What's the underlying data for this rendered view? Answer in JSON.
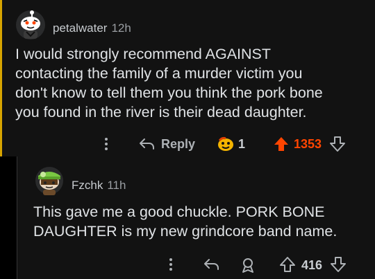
{
  "colors": {
    "background": "#000000",
    "comment_bg": "#121212",
    "thread_accent": "#d7a400",
    "upvote_active": "#ff4500",
    "text_primary": "#e0e3e6",
    "text_secondary": "#9a9ea2"
  },
  "comments": [
    {
      "username": "petalwater",
      "time": "12h",
      "body": "I would strongly recommend AGAINST\ncontacting the family of a murder victim you\ndon't know to tell them you think the pork bone\nyou found in the river is their dead daughter.",
      "actions": {
        "more_icon": "more-vertical-icon",
        "reply_icon": "reply-arrow-icon",
        "reply_label": "Reply",
        "award_icon": "award-icon",
        "award_count": "1",
        "upvote_icon": "upvote-arrow-icon",
        "vote_count": "1353",
        "downvote_icon": "downvote-arrow-icon"
      }
    },
    {
      "username": "Fzchk",
      "time": "11h",
      "body": "This gave me a good chuckle. PORK BONE\nDAUGHTER is my new grindcore band name.",
      "actions": {
        "more_icon": "more-vertical-icon",
        "reply_icon": "reply-arrow-icon",
        "award_icon": "award-outline-icon",
        "upvote_icon": "upvote-arrow-icon",
        "vote_count": "416",
        "downvote_icon": "downvote-arrow-icon"
      }
    }
  ]
}
